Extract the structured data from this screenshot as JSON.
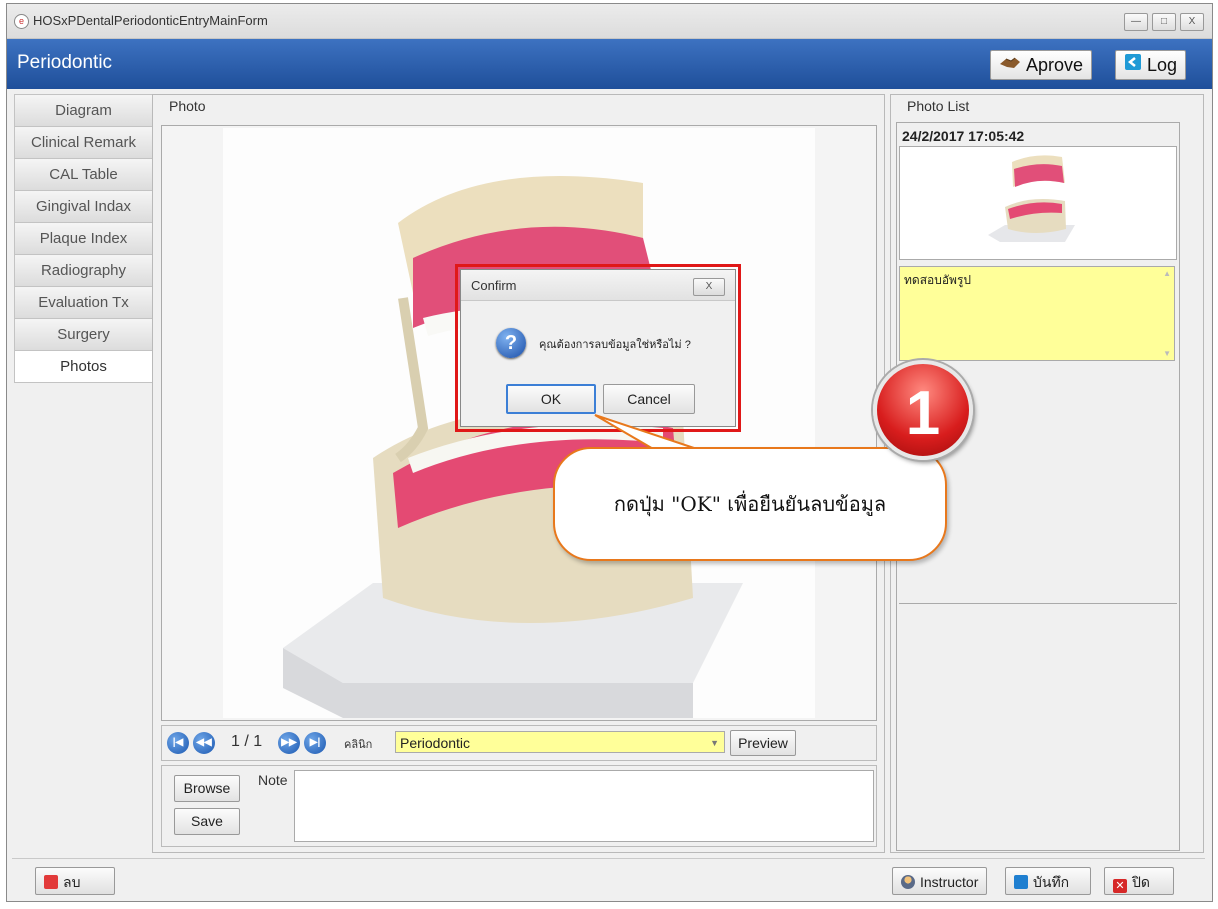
{
  "window": {
    "title": "HOSxPDentalPeriodonticEntryMainForm",
    "app_icon": "app-icon",
    "minimize": "—",
    "maximize": "□",
    "close": "X"
  },
  "header": {
    "title": "Periodontic",
    "approve_label": "Aprove",
    "log_label": "Log",
    "bg_color": "#2a5caa"
  },
  "tabs": [
    "Diagram",
    "Clinical Remark",
    "CAL Table",
    "Gingival Indax",
    "Plaque Index",
    "Radiography",
    "Evaluation Tx",
    "Surgery",
    "Photos"
  ],
  "active_tab": "Photos",
  "photo": {
    "group_label": "Photo",
    "page_indicator": "1 / 1",
    "clinic_label": "คลินิก",
    "clinic_value": "Periodontic",
    "preview_label": "Preview",
    "browse_label": "Browse",
    "save_label": "Save",
    "note_label": "Note",
    "note_value": ""
  },
  "photo_list": {
    "label": "Photo List",
    "timestamp": "24/2/2017 17:05:42",
    "note": "ทดสอบอัพรูป"
  },
  "dialog": {
    "title": "Confirm",
    "message": "คุณต้องการลบข้อมูลใช่หรือไม่ ?",
    "ok_label": "OK",
    "cancel_label": "Cancel",
    "icon": "question-icon",
    "close": "X"
  },
  "annotation": {
    "step_number": "1",
    "callout_text": "กดปุ่ม \"OK\" เพื่อยืนยันลบข้อมูล",
    "callout_border": "#e8781c",
    "badge_color": "#d81d1d",
    "highlight_color": "#e01818"
  },
  "bottom": {
    "delete_label": "ลบ",
    "instructor_label": "Instructor",
    "save_label": "บันทึก",
    "close_label": "ปิด"
  }
}
